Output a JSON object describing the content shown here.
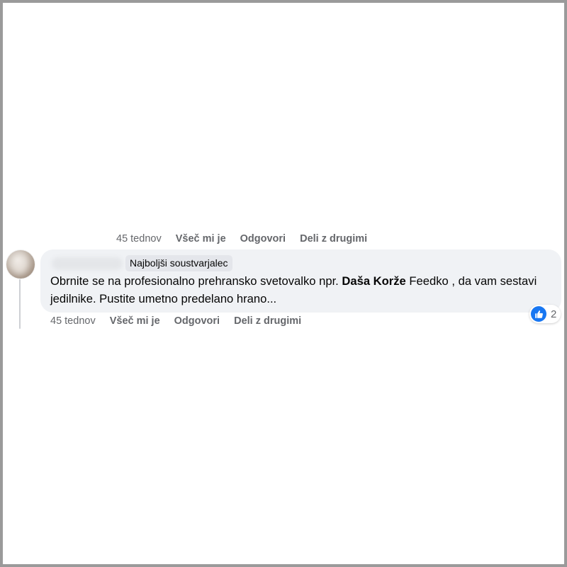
{
  "previous_comment_actions": {
    "time": "45 tednov",
    "like": "Všeč mi je",
    "reply": "Odgovori",
    "share": "Deli z drugimi"
  },
  "comment": {
    "author_badge": "Najboljši soustvarjalec",
    "text_before": "Obrnite se na profesionalno prehransko svetovalko npr. ",
    "mention": "Daša Korže",
    "text_after": " Feedko , da vam sestavi jedilnike. Pustite umetno predelano hrano...",
    "reaction_count": "2",
    "reaction_icon": "thumbs-up-icon",
    "reaction_color": "#1877f2",
    "actions": {
      "time": "45 tednov",
      "like": "Všeč mi je",
      "reply": "Odgovori",
      "share": "Deli z drugimi"
    }
  }
}
